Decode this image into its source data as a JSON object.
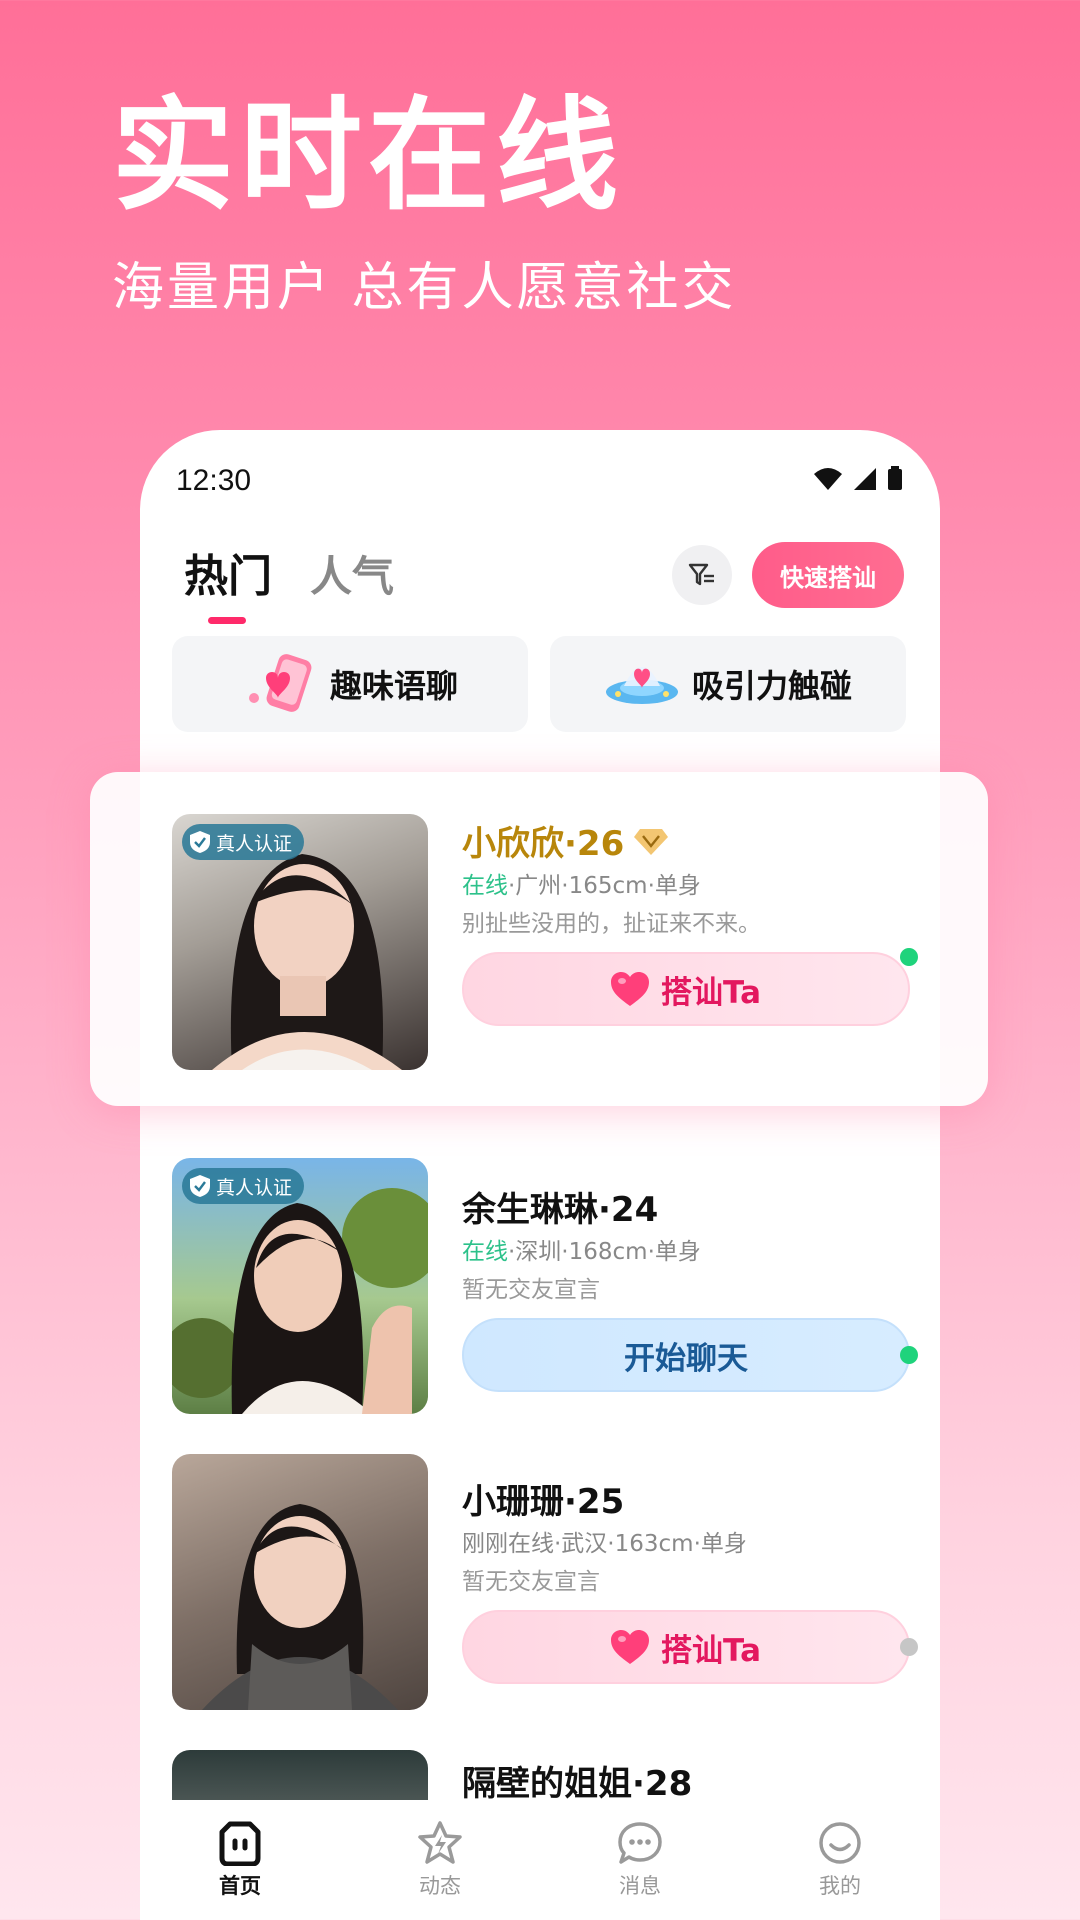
{
  "hero": {
    "title": "实时在线",
    "subtitle": "海量用户 总有人愿意社交"
  },
  "status_bar": {
    "time": "12:30"
  },
  "tabs": [
    {
      "label": "热门"
    },
    {
      "label": "人气"
    }
  ],
  "quick_button": "快速搭讪",
  "features": [
    {
      "label": "趣味语聊",
      "icon": "phone-heart-icon"
    },
    {
      "label": "吸引力触碰",
      "icon": "ufo-heart-icon"
    }
  ],
  "verify_label": "真人认证",
  "users": [
    {
      "name": "小欣欣·26",
      "status": "在线",
      "details": "·广州·165cm·单身",
      "bio": "别扯些没用的，扯证来不来。",
      "action": "搭讪Ta",
      "verified": true,
      "vip": true
    },
    {
      "name": "余生琳琳·24",
      "status": "在线",
      "details": "·深圳·168cm·单身",
      "bio": "暂无交友宣言",
      "action": "开始聊天",
      "verified": true
    },
    {
      "name": "小珊珊·25",
      "status": "",
      "details": "刚刚在线·武汉·163cm·单身",
      "bio": "暂无交友宣言",
      "action": "搭讪Ta",
      "verified": false
    },
    {
      "name": "隔壁的姐姐·28"
    }
  ],
  "nav": [
    {
      "label": "首页"
    },
    {
      "label": "动态"
    },
    {
      "label": "消息"
    },
    {
      "label": "我的"
    }
  ],
  "colors": {
    "accent": "#ff2a6a",
    "online": "#2cc18a",
    "vip_name": "#b8860b"
  }
}
